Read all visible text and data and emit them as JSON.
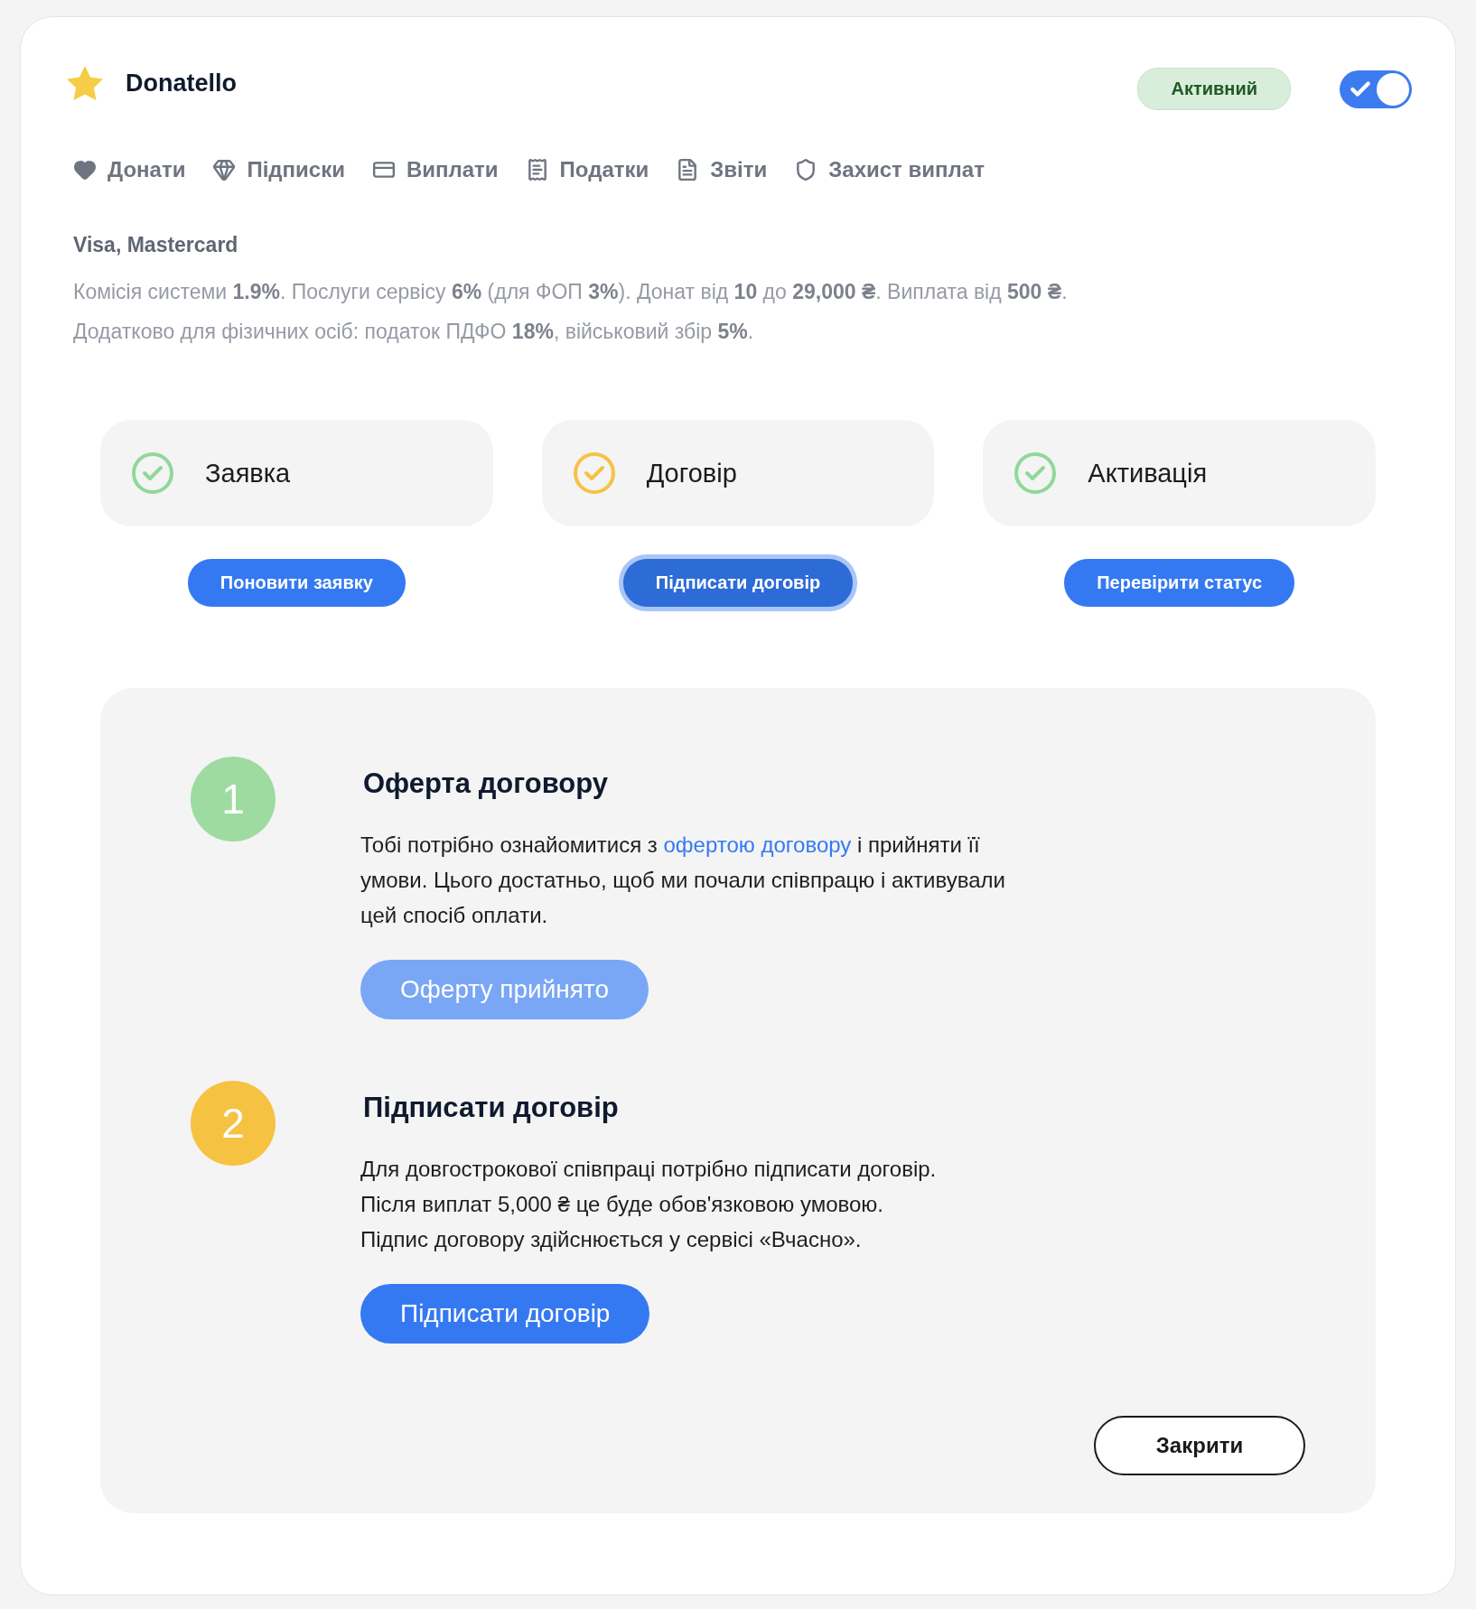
{
  "header": {
    "title": "Donatello",
    "status_badge": "Активний",
    "toggle": {
      "on": true
    }
  },
  "tabs": [
    {
      "label": "Донати"
    },
    {
      "label": "Підписки"
    },
    {
      "label": "Виплати"
    },
    {
      "label": "Податки"
    },
    {
      "label": "Звіти"
    },
    {
      "label": "Захист виплат"
    }
  ],
  "info": {
    "title": "Visa, Mastercard",
    "lines": [
      "Комісія системи **1.9%**. Послуги сервісу **6%** (для ФОП **3%**). Донат від **10** до **29,000 ₴**. Виплата від **500 ₴**.",
      "Додатково для фізичних осіб: податок ПДФО **18%**, військовий збір **5%**."
    ]
  },
  "stages": [
    {
      "label": "Заявка",
      "color": "#8fd89a",
      "button": "Поновити заявку",
      "focused": false
    },
    {
      "label": "Договір",
      "color": "#f5c242",
      "button": "Підписати договір",
      "focused": true
    },
    {
      "label": "Активація",
      "color": "#8fd89a",
      "button": "Перевірити статус",
      "focused": false
    }
  ],
  "instructions": [
    {
      "number": "1",
      "color": "#9edba0",
      "title": "Оферта договору",
      "text_before": "Тобі потрібно ознайомитися з ",
      "link": "офертою договору",
      "text_after": " і прийняти її умови. Цього достатньо, щоб ми почали співпрацю і активували цей спосіб оплати.",
      "button": "Оферту прийнято",
      "disabled": true
    },
    {
      "number": "2",
      "color": "#f5c242",
      "title": "Підписати договір",
      "lines": [
        "Для довгострокової співпраці потрібно підписати договір.",
        "Після виплат 5,000 ₴ це буде обов'язковою умовою.",
        "Підпис договору здійснюється у сервісі «Вчасно»."
      ],
      "button": "Підписати договір",
      "disabled": false
    }
  ],
  "close_button": "Закрити"
}
